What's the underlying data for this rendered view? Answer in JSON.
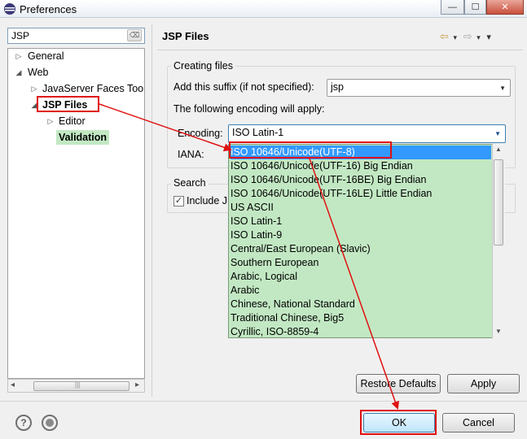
{
  "window": {
    "title": "Preferences",
    "min_glyph": "—",
    "max_glyph": "☐",
    "close_glyph": "✕"
  },
  "left": {
    "filter_value": "JSP",
    "filter_clear_glyph": "⌫",
    "tree": [
      {
        "label": "General",
        "twisty": "▷",
        "level": 0
      },
      {
        "label": "Web",
        "twisty": "◢",
        "level": 0
      },
      {
        "label": "JavaServer Faces Tool",
        "twisty": "▷",
        "level": 1
      },
      {
        "label": "JSP Files",
        "twisty": "◢",
        "level": 1,
        "selected": true
      },
      {
        "label": "Editor",
        "twisty": "▷",
        "level": 2
      },
      {
        "label": "Validation",
        "twisty": "",
        "level": 2
      }
    ],
    "hscroll_left": "◂",
    "hscroll_right": "▸",
    "hscroll_grip": "|||"
  },
  "right": {
    "title": "JSP Files",
    "nav_back": "⇦",
    "nav_forward": "⇨",
    "nav_menu": "▾",
    "creating_files": {
      "legend": "Creating files",
      "suffix_label": "Add this suffix (if not specified):",
      "suffix_value": "jsp",
      "encoding_note": "The following encoding will apply:",
      "encoding_label": "Encoding:",
      "encoding_value": "ISO Latin-1",
      "iana_label": "IANA:"
    },
    "search": {
      "legend": "Search",
      "checkbox_label": "Include J",
      "checked": true
    },
    "encoding_options": [
      "ISO 10646/Unicode(UTF-8)",
      "ISO 10646/Unicode(UTF-16) Big Endian",
      "ISO 10646/Unicode(UTF-16BE) Big Endian",
      "ISO 10646/Unicode(UTF-16LE) Little Endian",
      "US ASCII",
      "ISO Latin-1",
      "ISO Latin-9",
      "Central/East European (Slavic)",
      "Southern European",
      "Arabic, Logical",
      "Arabic",
      "Chinese, National Standard",
      "Traditional Chinese, Big5",
      "Cyrillic, ISO-8859-4"
    ],
    "highlighted_option_index": 0,
    "restore_defaults": "Restore Defaults",
    "apply": "Apply"
  },
  "footer": {
    "help_glyph": "?",
    "ok": "OK",
    "cancel": "Cancel"
  },
  "colors": {
    "dropdown_bg": "#c2e8c3",
    "selection": "#3399ff",
    "annotation_red": "#e01010"
  }
}
